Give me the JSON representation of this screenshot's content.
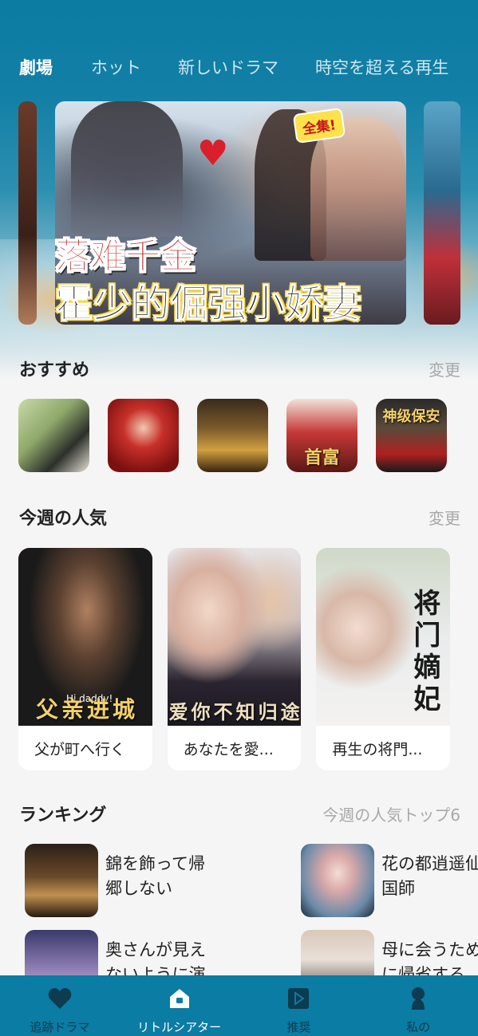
{
  "top_tabs": [
    {
      "label": "劇場",
      "active": true
    },
    {
      "label": "ホット",
      "active": false
    },
    {
      "label": "新しいドラマ",
      "active": false
    },
    {
      "label": "時空を超える再生",
      "active": false
    }
  ],
  "banner": {
    "badge": "全集!",
    "title_line1": "落难千金",
    "title_line2": "霍少的倔强小娇妻"
  },
  "recommend": {
    "title": "おすすめ",
    "more": "変更",
    "items": [
      {
        "overlay": ""
      },
      {
        "overlay": ""
      },
      {
        "overlay": ""
      },
      {
        "overlay": "首富"
      },
      {
        "overlay": "神级保安"
      }
    ]
  },
  "weekly": {
    "title": "今週の人気",
    "more": "変更",
    "items": [
      {
        "title": "父が町へ行く",
        "overlay": "父亲进城",
        "tag": "Hi,daddy!"
      },
      {
        "title": "あなたを愛...",
        "overlay": "爱你不知归途",
        "tag": ""
      },
      {
        "title": "再生の将門...",
        "overlay": "将门嫡妃",
        "tag": ""
      }
    ]
  },
  "ranking": {
    "title": "ランキング",
    "subtitle": "今週の人気トップ6",
    "items": [
      {
        "title": "錦を飾って帰郷しない"
      },
      {
        "title": "花の都逍遥仙国師"
      },
      {
        "title": "奥さんが見えないように演"
      },
      {
        "title": "母に会うために帰省する"
      }
    ]
  },
  "bottom_nav": [
    {
      "label": "追跡ドラマ",
      "icon": "heart-icon",
      "active": false
    },
    {
      "label": "リトルシアター",
      "icon": "home-icon",
      "active": true
    },
    {
      "label": "推奨",
      "icon": "play-icon",
      "active": false
    },
    {
      "label": "私の",
      "icon": "user-icon",
      "active": false
    }
  ],
  "colors": {
    "primary": "#0b7ca3",
    "nav_inactive": "#0d3b4f",
    "muted": "#a8a8a8"
  }
}
